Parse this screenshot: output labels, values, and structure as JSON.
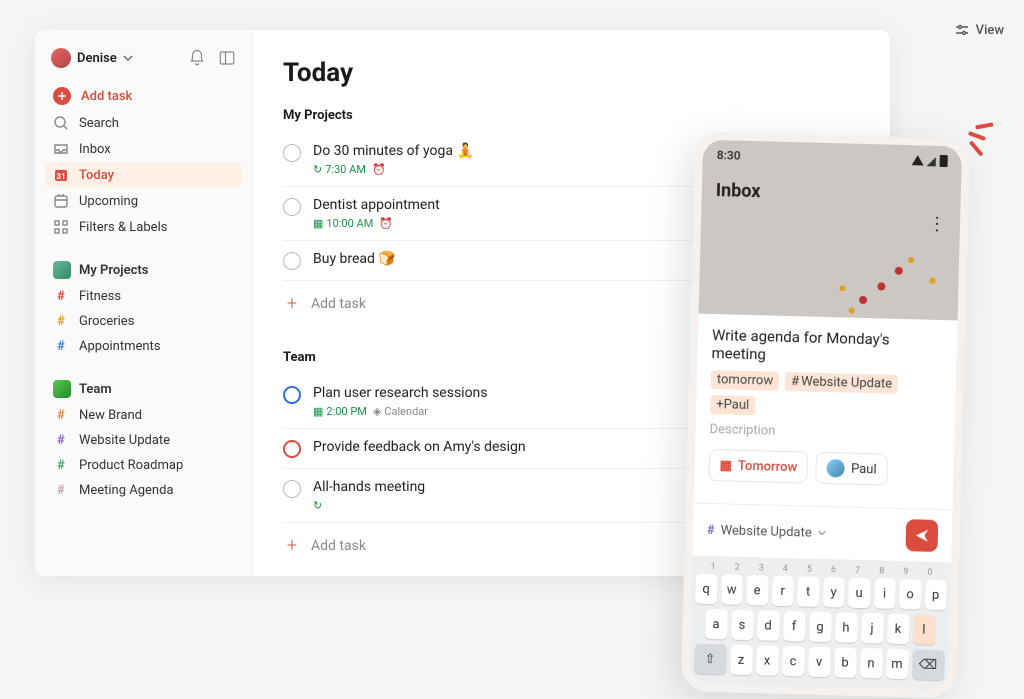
{
  "user": {
    "name": "Denise"
  },
  "top": {
    "view": "View"
  },
  "sidebar": {
    "add": "Add task",
    "search": "Search",
    "inbox": "Inbox",
    "today": "Today",
    "upcoming": "Upcoming",
    "filters": "Filters & Labels",
    "myProjectsTitle": "My Projects",
    "myProjects": [
      {
        "label": "Fitness",
        "color": "#dc4c3e"
      },
      {
        "label": "Groceries",
        "color": "#e0a020"
      },
      {
        "label": "Appointments",
        "color": "#3b82d6"
      }
    ],
    "teamTitle": "Team",
    "teamProjects": [
      {
        "label": "New Brand",
        "color": "#dc8a3e"
      },
      {
        "label": "Website Update",
        "color": "#8a6bc9"
      },
      {
        "label": "Product Roadmap",
        "color": "#4fa36b"
      },
      {
        "label": "Meeting Agenda",
        "color": "#c9a6b9"
      }
    ]
  },
  "main": {
    "title": "Today",
    "sections": [
      {
        "title": "My Projects",
        "tasks": [
          {
            "title": "Do 30 minutes of yoga 🧘",
            "time": "7:30 AM",
            "recurring": true,
            "alarm": true
          },
          {
            "title": "Dentist appointment",
            "time": "10:00 AM",
            "calendar": true,
            "alarm": true
          },
          {
            "title": "Buy bread 🍞"
          }
        ],
        "addLabel": "Add task"
      },
      {
        "title": "Team",
        "tasks": [
          {
            "title": "Plan user research sessions",
            "circle": "blue",
            "time": "2:00 PM",
            "calendar": true,
            "tag": "Calendar"
          },
          {
            "title": "Provide feedback on Amy's design",
            "circle": "red"
          },
          {
            "title": "All-hands meeting",
            "recurring": true
          }
        ],
        "addLabel": "Add task"
      }
    ]
  },
  "phone": {
    "time": "8:30",
    "inbox": "Inbox",
    "taskTitle": "Write agenda for Monday's meeting",
    "chips": [
      "tomorrow",
      "#Website Update",
      "+Paul"
    ],
    "description": "Description",
    "tomorrowPill": "Tomorrow",
    "paulPill": "Paul",
    "project": "Website Update",
    "keyboard": {
      "row1": [
        "q",
        "w",
        "e",
        "r",
        "t",
        "y",
        "u",
        "i",
        "o",
        "p"
      ],
      "nums": [
        "1",
        "2",
        "3",
        "4",
        "5",
        "6",
        "7",
        "8",
        "9",
        "0"
      ],
      "row2": [
        "a",
        "s",
        "d",
        "f",
        "g",
        "h",
        "j",
        "k",
        "l"
      ],
      "row3": [
        "z",
        "x",
        "c",
        "v",
        "b",
        "n",
        "m"
      ]
    }
  }
}
